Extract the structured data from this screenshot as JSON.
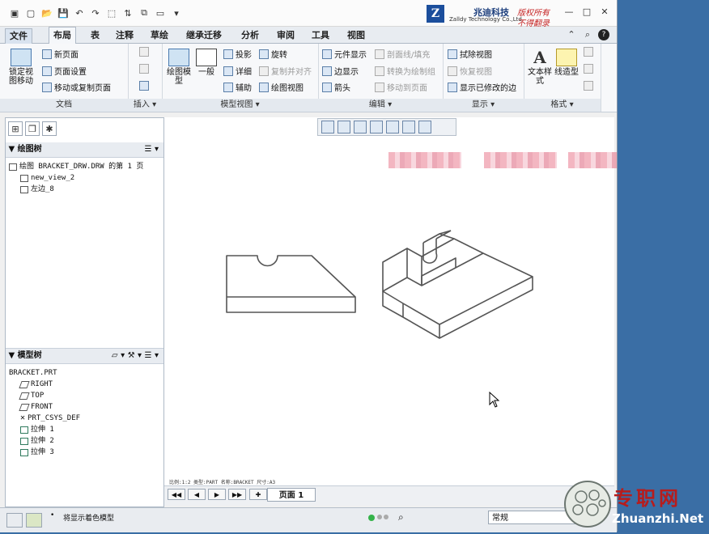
{
  "titlebar": {
    "logo_letter": "Z",
    "logo_cn": "兆迪科技",
    "logo_en": "Zalldy Technology Co.,Ltd.",
    "red_line1": "版权所有",
    "red_line2": "不得翻录"
  },
  "tabs": [
    "文件",
    "布局",
    "表",
    "注释",
    "草绘",
    "继承迁移",
    "分析",
    "审阅",
    "工具",
    "视图"
  ],
  "ribbon": {
    "doc": {
      "lock_btn": "锁定视图移动",
      "new_page": "新页面",
      "page_setup": "页面设置",
      "move_copy": "移动或复制页面",
      "label": "文档"
    },
    "insert": {
      "label": "插入"
    },
    "model_views": {
      "drawing_model": "绘图模型",
      "general": "一般",
      "projection": "投影",
      "detailed": "详细",
      "auxiliary": "辅助",
      "rotate": "旋转",
      "copy_align": "复制并对齐",
      "drawing_view": "绘图视图",
      "label": "模型视图"
    },
    "edit": {
      "element_display": "元件显示",
      "edge_display": "边显示",
      "arrow": "箭头",
      "section_fill": "剖面线/填充",
      "convert": "转换为绘制组",
      "move_to_page": "移动到页面",
      "label": "编辑"
    },
    "display": {
      "erase_view": "拭除视图",
      "restore_view": "恢复视图",
      "show_modified_edges": "显示已修改的边",
      "label": "显示"
    },
    "format": {
      "text_style": "文本样式",
      "line_style": "线造型",
      "label": "格式"
    }
  },
  "drawing_tree": {
    "title": "绘图树",
    "items": [
      "绘图 BRACKET_DRW.DRW 的第 1 页",
      "new_view_2",
      "左边_8"
    ]
  },
  "model_tree": {
    "title": "模型树",
    "items": [
      "BRACKET.PRT",
      "RIGHT",
      "TOP",
      "FRONT",
      "PRT_CSYS_DEF",
      "拉伸 1",
      "拉伸 2",
      "拉伸 3"
    ]
  },
  "canvas": {
    "model_info": "比例:1:2      类型:PART   名称:BRACKET   尺寸:A3"
  },
  "sheet": {
    "page_label": "页面 1"
  },
  "status": {
    "message": "将显示着色模型",
    "filter_value": "常规"
  },
  "watermark": {
    "cn": "专职网",
    "en": "Zhuanzhi.Net"
  }
}
